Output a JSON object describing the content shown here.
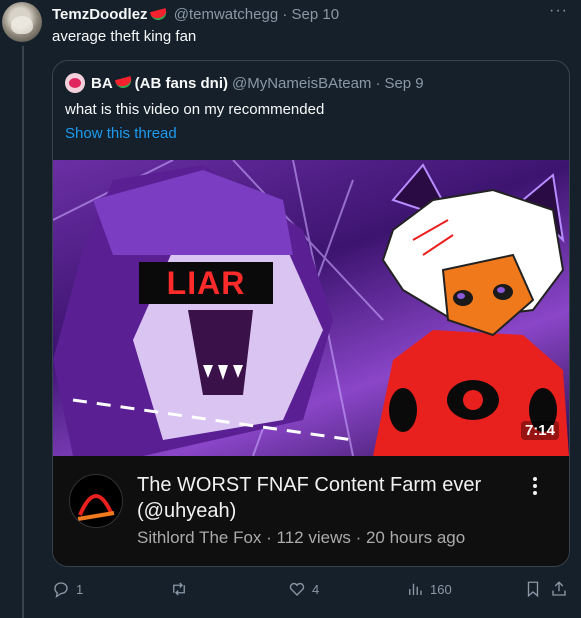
{
  "tweet": {
    "display_name": "TemzDoodlez",
    "handle": "@temwatchegg",
    "separator": "·",
    "date": "Sep 10",
    "text": "average theft king fan"
  },
  "quote": {
    "display_name": "BA",
    "name_suffix": "(AB fans dni)",
    "handle": "@MyNameisBAteam",
    "separator": "·",
    "date": "Sep 9",
    "text": "what is this video on my recommended",
    "show_thread": "Show this thread"
  },
  "video": {
    "overlay_text": "LIAR",
    "duration": "7:14",
    "title": "The WORST FNAF Content Farm ever (@uhyeah)",
    "meta": "Sithlord The Fox · 112 views · 20 hours ago"
  },
  "actions": {
    "replies": "1",
    "retweets": "",
    "likes": "4",
    "views": "160"
  },
  "colors": {
    "background": "#15202b",
    "link": "#1d9bf0",
    "muted": "#8b98a5",
    "border": "#38444d",
    "liar_text": "#ff2a2a",
    "red_character": "#e8201e",
    "purple": "#6b2fa5"
  },
  "icons": [
    "more-icon",
    "watermelon-icon",
    "reply-icon",
    "retweet-icon",
    "like-icon",
    "views-icon",
    "bookmark-icon",
    "share-icon",
    "kebab-icon"
  ]
}
